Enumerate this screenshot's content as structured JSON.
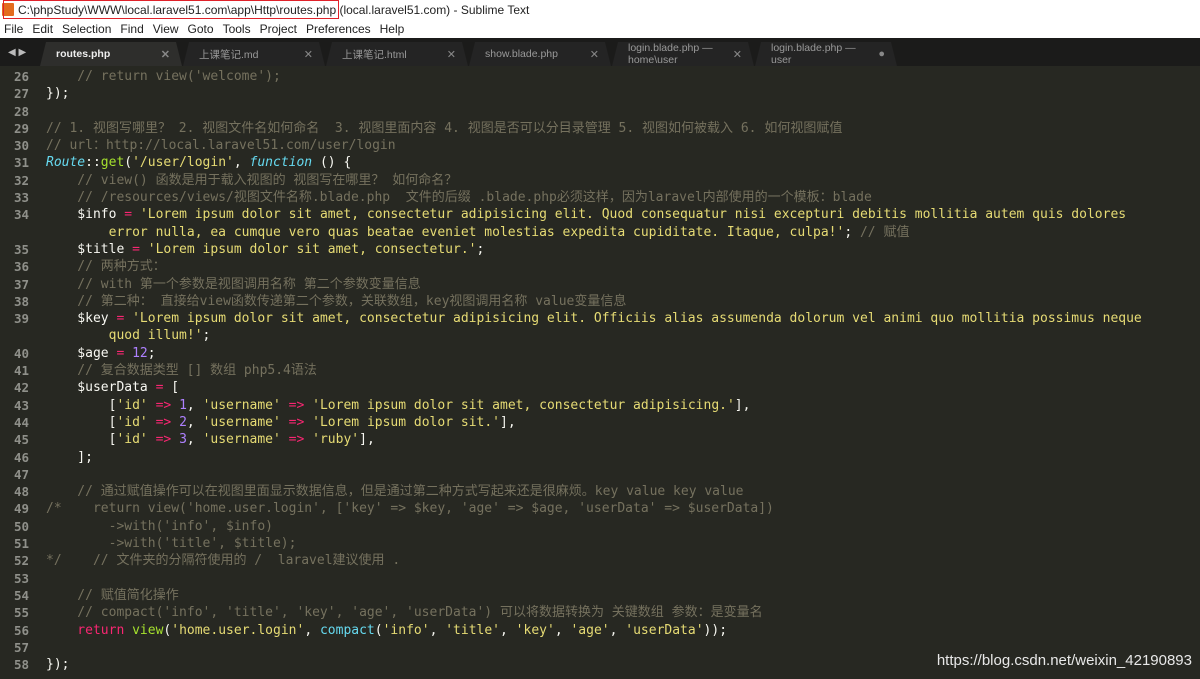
{
  "window": {
    "title": "C:\\phpStudy\\WWW\\local.laravel51.com\\app\\Http\\routes.php (local.laravel51.com) - Sublime Text"
  },
  "menu": [
    "File",
    "Edit",
    "Selection",
    "Find",
    "View",
    "Goto",
    "Tools",
    "Project",
    "Preferences",
    "Help"
  ],
  "tabs": [
    {
      "label": "routes.php",
      "close": "✕",
      "active": true
    },
    {
      "label": "上课笔记.md",
      "close": "✕"
    },
    {
      "label": "上课笔记.html",
      "close": "✕"
    },
    {
      "label": "show.blade.php",
      "close": "✕"
    },
    {
      "label": "login.blade.php — home\\user",
      "close": "✕"
    },
    {
      "label": "login.blade.php — user",
      "close": "●"
    }
  ],
  "nav_arrows": "◀ ▶",
  "lines": [
    {
      "n": "26",
      "t": [
        [
          "c",
          "    // return view('welcome');"
        ]
      ]
    },
    {
      "n": "27",
      "t": [
        [
          "p",
          "});"
        ]
      ]
    },
    {
      "n": "28",
      "t": []
    },
    {
      "n": "29",
      "t": [
        [
          "c",
          "// 1. 视图写哪里？ 2. 视图文件名如何命名  3. 视图里面内容 4. 视图是否可以分目录管理 5. 视图如何被载入 6. 如何视图赋值"
        ]
      ]
    },
    {
      "n": "30",
      "t": [
        [
          "c",
          "// url：http://local.laravel51.com/user/login"
        ]
      ]
    },
    {
      "n": "31",
      "t": [
        [
          "t",
          "Route"
        ],
        [
          "p",
          "::"
        ],
        [
          "f",
          "get"
        ],
        [
          "p",
          "("
        ],
        [
          "s",
          "'/user/login'"
        ],
        [
          "p",
          ", "
        ],
        [
          "t",
          "function"
        ],
        [
          "p",
          " () {"
        ]
      ]
    },
    {
      "n": "32",
      "t": [
        [
          "c",
          "    // view() 函数是用于载入视图的 视图写在哪里？ 如何命名？"
        ]
      ]
    },
    {
      "n": "33",
      "t": [
        [
          "c",
          "    // /resources/views/视图文件名称.blade.php  文件的后缀 .blade.php必须这样，因为laravel内部使用的一个模板：blade"
        ]
      ]
    },
    {
      "n": "34",
      "t": [
        [
          "p",
          "    $info "
        ],
        [
          "k",
          "="
        ],
        [
          "p",
          " "
        ],
        [
          "s",
          "'Lorem ipsum dolor sit amet, consectetur adipisicing elit. Quod consequatur nisi excepturi debitis mollitia autem quis dolores"
        ]
      ]
    },
    {
      "n": "",
      "t": [
        [
          "s",
          "        error nulla, ea cumque vero quas beatae eveniet molestias expedita cupiditate. Itaque, culpa!'"
        ],
        [
          "p",
          ";"
        ],
        [
          "c",
          " // 赋值"
        ]
      ]
    },
    {
      "n": "35",
      "t": [
        [
          "p",
          "    $title "
        ],
        [
          "k",
          "="
        ],
        [
          "p",
          " "
        ],
        [
          "s",
          "'Lorem ipsum dolor sit amet, consectetur.'"
        ],
        [
          "p",
          ";"
        ]
      ]
    },
    {
      "n": "36",
      "t": [
        [
          "c",
          "    // 两种方式："
        ]
      ]
    },
    {
      "n": "37",
      "t": [
        [
          "c",
          "    // with 第一个参数是视图调用名称 第二个参数变量信息"
        ]
      ]
    },
    {
      "n": "38",
      "t": [
        [
          "c",
          "    // 第二种： 直接给view函数传递第二个参数，关联数组，key视图调用名称 value变量信息"
        ]
      ]
    },
    {
      "n": "39",
      "t": [
        [
          "p",
          "    $key "
        ],
        [
          "k",
          "="
        ],
        [
          "p",
          " "
        ],
        [
          "s",
          "'Lorem ipsum dolor sit amet, consectetur adipisicing elit. Officiis alias assumenda dolorum vel animi quo mollitia possimus neque"
        ]
      ]
    },
    {
      "n": "",
      "t": [
        [
          "s",
          "        quod illum!'"
        ],
        [
          "p",
          ";"
        ]
      ]
    },
    {
      "n": "40",
      "t": [
        [
          "p",
          "    $age "
        ],
        [
          "k",
          "="
        ],
        [
          "p",
          " "
        ],
        [
          "n",
          "12"
        ],
        [
          "p",
          ";"
        ]
      ]
    },
    {
      "n": "41",
      "t": [
        [
          "c",
          "    // 复合数据类型 [] 数组 php5.4语法"
        ]
      ]
    },
    {
      "n": "42",
      "t": [
        [
          "p",
          "    $userData "
        ],
        [
          "k",
          "="
        ],
        [
          "p",
          " ["
        ]
      ]
    },
    {
      "n": "43",
      "t": [
        [
          "p",
          "        ["
        ],
        [
          "s",
          "'id'"
        ],
        [
          "p",
          " "
        ],
        [
          "k",
          "=>"
        ],
        [
          "p",
          " "
        ],
        [
          "n",
          "1"
        ],
        [
          "p",
          ", "
        ],
        [
          "s",
          "'username'"
        ],
        [
          "p",
          " "
        ],
        [
          "k",
          "=>"
        ],
        [
          "p",
          " "
        ],
        [
          "s",
          "'Lorem ipsum dolor sit amet, consectetur adipisicing.'"
        ],
        [
          "p",
          "],"
        ]
      ]
    },
    {
      "n": "44",
      "t": [
        [
          "p",
          "        ["
        ],
        [
          "s",
          "'id'"
        ],
        [
          "p",
          " "
        ],
        [
          "k",
          "=>"
        ],
        [
          "p",
          " "
        ],
        [
          "n",
          "2"
        ],
        [
          "p",
          ", "
        ],
        [
          "s",
          "'username'"
        ],
        [
          "p",
          " "
        ],
        [
          "k",
          "=>"
        ],
        [
          "p",
          " "
        ],
        [
          "s",
          "'Lorem ipsum dolor sit.'"
        ],
        [
          "p",
          "],"
        ]
      ]
    },
    {
      "n": "45",
      "t": [
        [
          "p",
          "        ["
        ],
        [
          "s",
          "'id'"
        ],
        [
          "p",
          " "
        ],
        [
          "k",
          "=>"
        ],
        [
          "p",
          " "
        ],
        [
          "n",
          "3"
        ],
        [
          "p",
          ", "
        ],
        [
          "s",
          "'username'"
        ],
        [
          "p",
          " "
        ],
        [
          "k",
          "=>"
        ],
        [
          "p",
          " "
        ],
        [
          "s",
          "'ruby'"
        ],
        [
          "p",
          "],"
        ]
      ]
    },
    {
      "n": "46",
      "t": [
        [
          "p",
          "    ];"
        ]
      ]
    },
    {
      "n": "47",
      "t": []
    },
    {
      "n": "48",
      "t": [
        [
          "c",
          "    // 通过赋值操作可以在视图里面显示数据信息，但是通过第二种方式写起来还是很麻烦。key value key value"
        ]
      ]
    },
    {
      "n": "49",
      "t": [
        [
          "c",
          "/*    return view('home.user.login', ['key' => $key, 'age' => $age, 'userData' => $userData])"
        ]
      ]
    },
    {
      "n": "50",
      "t": [
        [
          "c",
          "        ->with('info', $info)"
        ]
      ]
    },
    {
      "n": "51",
      "t": [
        [
          "c",
          "        ->with('title', $title);"
        ]
      ]
    },
    {
      "n": "52",
      "t": [
        [
          "c",
          "*/    // 文件夹的分隔符使用的 /  laravel建议使用 ."
        ]
      ]
    },
    {
      "n": "53",
      "t": []
    },
    {
      "n": "54",
      "t": [
        [
          "c",
          "    // 赋值简化操作"
        ]
      ]
    },
    {
      "n": "55",
      "t": [
        [
          "c",
          "    // compact('info', 'title', 'key', 'age', 'userData') 可以将数据转换为 关键数组 参数：是变量名"
        ]
      ]
    },
    {
      "n": "56",
      "t": [
        [
          "k",
          "    return"
        ],
        [
          "p",
          " "
        ],
        [
          "f",
          "view"
        ],
        [
          "p",
          "("
        ],
        [
          "s",
          "'home.user.login'"
        ],
        [
          "p",
          ", "
        ],
        [
          "cy",
          "compact"
        ],
        [
          "p",
          "("
        ],
        [
          "s",
          "'info'"
        ],
        [
          "p",
          ", "
        ],
        [
          "s",
          "'title'"
        ],
        [
          "p",
          ", "
        ],
        [
          "s",
          "'key'"
        ],
        [
          "p",
          ", "
        ],
        [
          "s",
          "'age'"
        ],
        [
          "p",
          ", "
        ],
        [
          "s",
          "'userData'"
        ],
        [
          "p",
          "));"
        ]
      ]
    },
    {
      "n": "57",
      "t": []
    },
    {
      "n": "58",
      "t": [
        [
          "p",
          "});"
        ]
      ]
    }
  ],
  "watermark": "https://blog.csdn.net/weixin_42190893",
  "colors": {
    "background": "#272822",
    "comment": "#75715e",
    "string": "#e6db74",
    "keyword": "#f92672",
    "function": "#a6e22e",
    "type": "#66d9ef",
    "number": "#ae81ff",
    "highlight_box": "#e0222a"
  }
}
